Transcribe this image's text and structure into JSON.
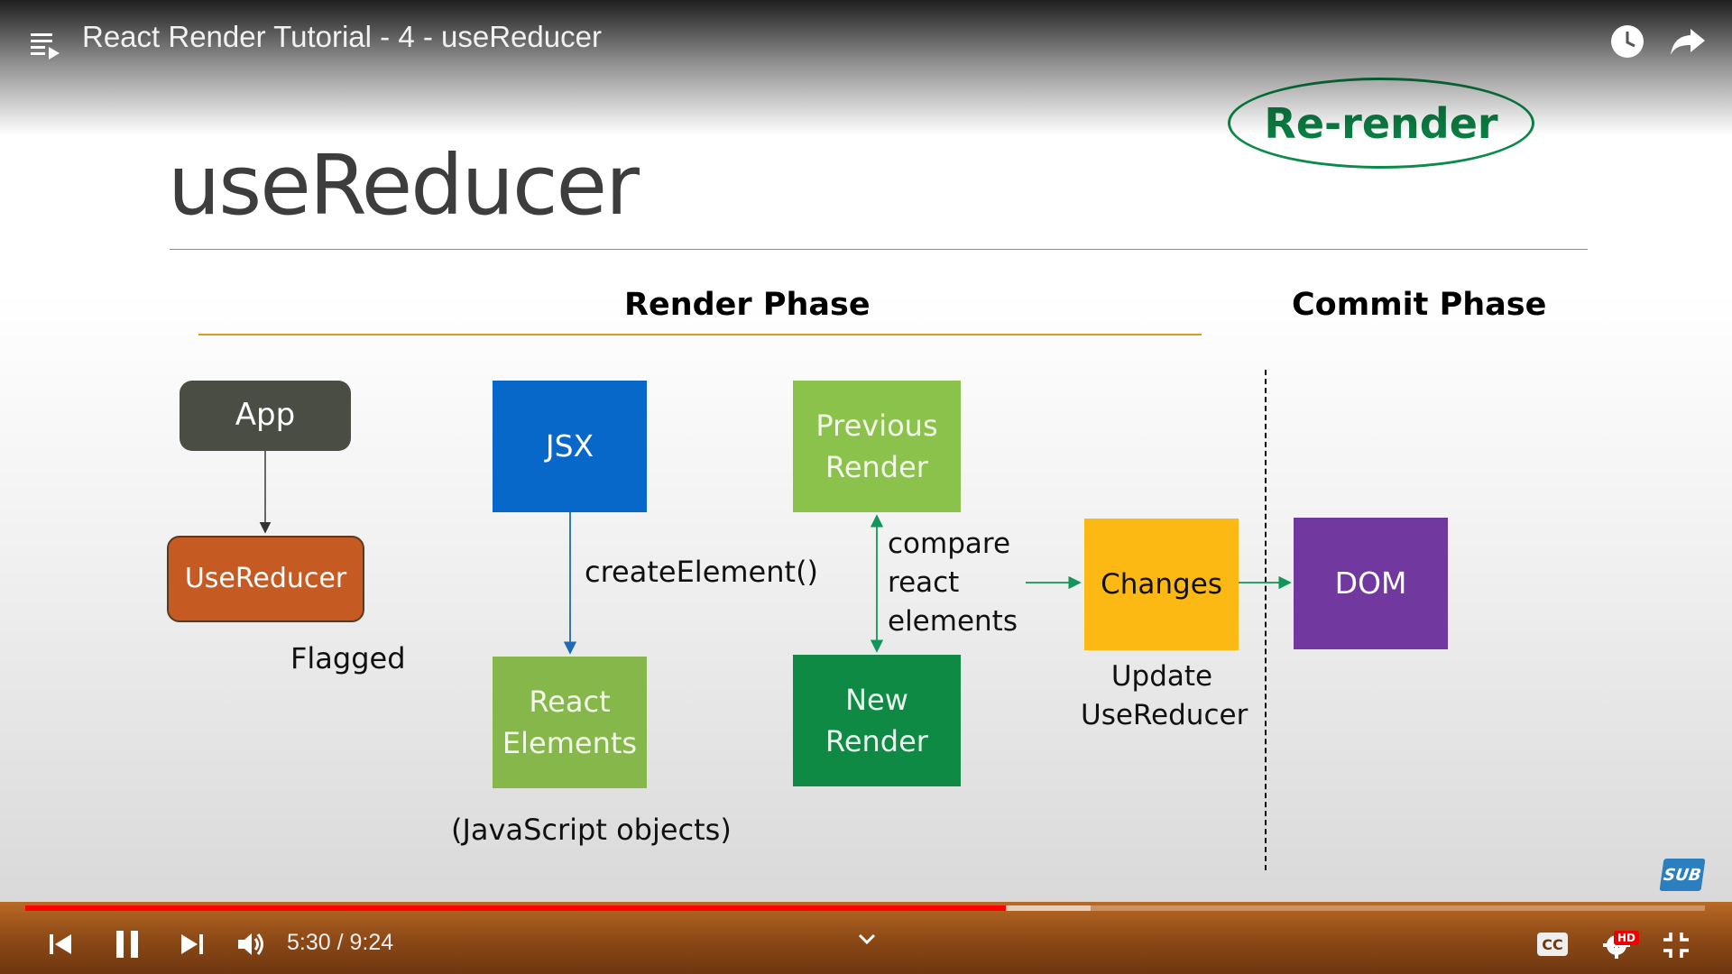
{
  "player": {
    "video_title": "React Render Tutorial - 4 - useReducer",
    "icons": [
      "playlist-icon",
      "watch-later-icon",
      "share-icon",
      "skip-previous-icon",
      "pause-icon",
      "skip-next-icon",
      "volume-icon",
      "chevron-down-icon",
      "captions-icon",
      "settings-icon",
      "exit-fullscreen-icon"
    ],
    "time_display": "5:30 / 9:24",
    "played_fraction": 0.584,
    "buffered_fraction": 0.634,
    "settings_badge": "HD",
    "captions_label": "CC",
    "channel_badge": "SUB"
  },
  "slide": {
    "title": "useReducer",
    "badge": "Re-render",
    "render_phase_label": "Render Phase",
    "commit_phase_label": "Commit Phase",
    "boxes": {
      "app": "App",
      "usereducer": "UseReducer",
      "jsx": "JSX",
      "react_elements": [
        "React",
        "Elements"
      ],
      "previous_render": [
        "Previous",
        "Render"
      ],
      "new_render": [
        "New",
        "Render"
      ],
      "changes": "Changes",
      "dom": "DOM"
    },
    "labels": {
      "flagged": "Flagged",
      "create_element": "createElement()",
      "js_objects": "(JavaScript objects)",
      "compare": [
        "compare",
        "react",
        "elements"
      ],
      "update": [
        "Update",
        "UseReducer"
      ]
    },
    "colors": {
      "app": "#4a4d44",
      "usereducer": "#c55a22",
      "jsx": "#0868c9",
      "react_elements": "#86b74a",
      "previous_render": "#8bc24c",
      "new_render": "#0e8a45",
      "changes": "#fdb913",
      "dom": "#7138a0",
      "accent": "#0b8a4a"
    }
  }
}
